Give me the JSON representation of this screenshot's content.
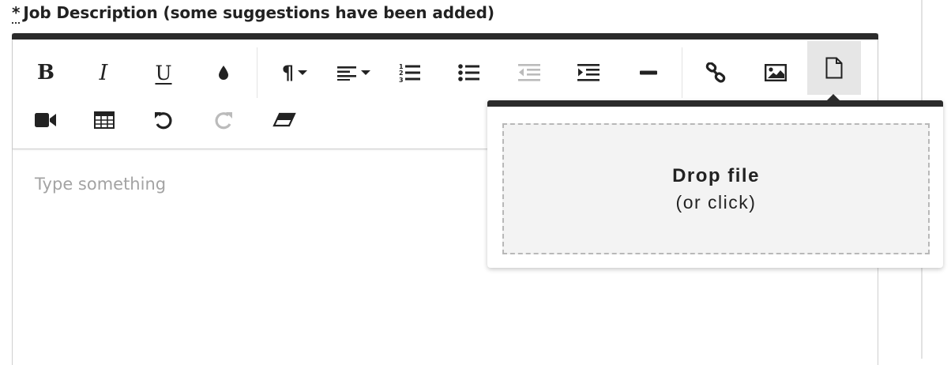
{
  "field": {
    "required_marker": "*",
    "label": "Job Description (some suggestions have been added)"
  },
  "toolbar": {
    "row1": [
      {
        "name": "bold-button",
        "icon": "bold-icon",
        "glyph": "B"
      },
      {
        "name": "italic-button",
        "icon": "italic-icon",
        "glyph": "I"
      },
      {
        "name": "underline-button",
        "icon": "underline-icon",
        "glyph": "U"
      },
      {
        "name": "text-color-button",
        "icon": "droplet-icon"
      },
      {
        "name": "paragraph-format-button",
        "icon": "pilcrow-icon",
        "glyph": "¶"
      },
      {
        "name": "align-button",
        "icon": "align-left-icon"
      },
      {
        "name": "ordered-list-button",
        "icon": "ordered-list-icon"
      },
      {
        "name": "unordered-list-button",
        "icon": "unordered-list-icon"
      },
      {
        "name": "outdent-button",
        "icon": "outdent-icon",
        "disabled": true
      },
      {
        "name": "indent-button",
        "icon": "indent-icon"
      },
      {
        "name": "horizontal-line-button",
        "icon": "minus-icon"
      },
      {
        "name": "insert-link-button",
        "icon": "link-icon"
      },
      {
        "name": "insert-image-button",
        "icon": "image-icon"
      },
      {
        "name": "insert-file-button",
        "icon": "file-icon",
        "active": true
      }
    ],
    "row2": [
      {
        "name": "insert-video-button",
        "icon": "video-camera-icon"
      },
      {
        "name": "insert-table-button",
        "icon": "table-icon"
      },
      {
        "name": "undo-button",
        "icon": "undo-icon"
      },
      {
        "name": "redo-button",
        "icon": "redo-icon",
        "disabled": true
      },
      {
        "name": "clear-formatting-button",
        "icon": "eraser-icon"
      }
    ]
  },
  "editor": {
    "placeholder": "Type something"
  },
  "file_popup": {
    "drop_title": "Drop file",
    "drop_subtitle": "(or click)"
  },
  "colors": {
    "toolbar_bar": "#2b2b2b",
    "icon": "#222222",
    "icon_disabled": "#bbbbbb",
    "active_button_bg": "#e6e6e6",
    "placeholder": "#a3a3a3"
  }
}
